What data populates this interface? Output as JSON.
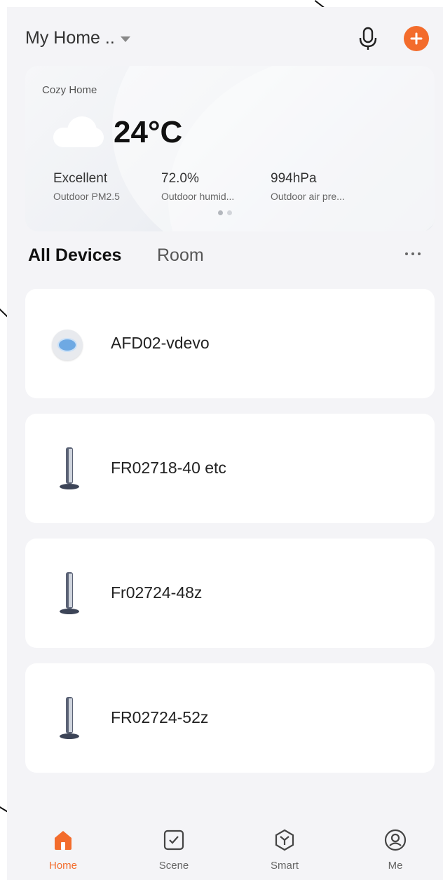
{
  "header": {
    "home_name": "My Home ..",
    "mic_icon": "microphone-icon",
    "add_icon": "plus-icon"
  },
  "weather": {
    "home_label": "Cozy Home",
    "temperature": "24°C",
    "condition_icon": "cloud-icon",
    "stats": [
      {
        "value": "Excellent",
        "label": "Outdoor PM2.5"
      },
      {
        "value": "72.0%",
        "label": "Outdoor humid..."
      },
      {
        "value": "994hPa",
        "label": "Outdoor air pre..."
      }
    ],
    "page_indicator": {
      "count": 2,
      "active": 1
    }
  },
  "tabs": {
    "all_devices": "All Devices",
    "room": "Room",
    "more_icon": "more-horizontal-icon"
  },
  "devices": [
    {
      "name": "AFD02-vdevo",
      "icon": "thermostat-icon"
    },
    {
      "name": "FR02718-40 etc",
      "icon": "tower-fan-icon"
    },
    {
      "name": "Fr02724-48z",
      "icon": "tower-fan-icon"
    },
    {
      "name": "FR02724-52z",
      "icon": "tower-fan-icon"
    }
  ],
  "nav": {
    "items": [
      {
        "label": "Home",
        "icon": "home-icon",
        "active": true
      },
      {
        "label": "Scene",
        "icon": "checkbox-icon",
        "active": false
      },
      {
        "label": "Smart",
        "icon": "smart-hexagon-icon",
        "active": false
      },
      {
        "label": "Me",
        "icon": "user-icon",
        "active": false
      }
    ]
  },
  "colors": {
    "accent": "#f36c2c",
    "background": "#f4f4f7"
  }
}
